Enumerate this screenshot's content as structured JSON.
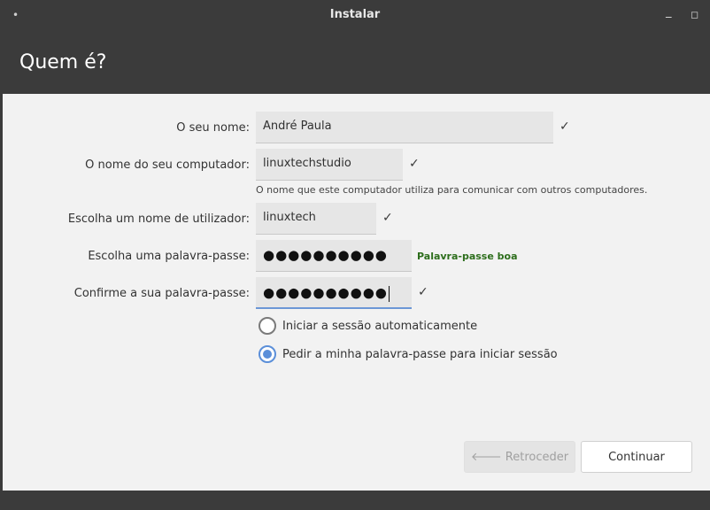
{
  "window": {
    "title": "Instalar",
    "menu_icon": "dot-menu-icon",
    "minimize_label": "_",
    "maximize_label": "◻"
  },
  "header": {
    "title": "Quem é?"
  },
  "form": {
    "name": {
      "label": "O seu nome:",
      "value": "André Paula"
    },
    "computer": {
      "label": "O nome do seu computador:",
      "value": "linuxtechstudio",
      "hint": "O nome que este computador utiliza para comunicar com outros computadores."
    },
    "username": {
      "label": "Escolha um nome de utilizador:",
      "value": "linuxtech"
    },
    "password": {
      "label": "Escolha uma palavra-passe:",
      "masked": "●●●●●●●●●●",
      "strength": "Palavra-passe boa"
    },
    "confirm": {
      "label": "Confirme a sua palavra-passe:",
      "masked": "●●●●●●●●●●"
    },
    "check_glyph": "✓",
    "login_options": [
      {
        "label": "Iniciar a sessão automaticamente",
        "checked": false
      },
      {
        "label": "Pedir a minha palavra-passe para iniciar sessão",
        "checked": true
      }
    ]
  },
  "buttons": {
    "back": "Retroceder",
    "continue": "Continuar"
  },
  "colors": {
    "chrome": "#3b3b3b",
    "accent": "#5b8fd9",
    "strength_good": "#2d6e1c"
  }
}
